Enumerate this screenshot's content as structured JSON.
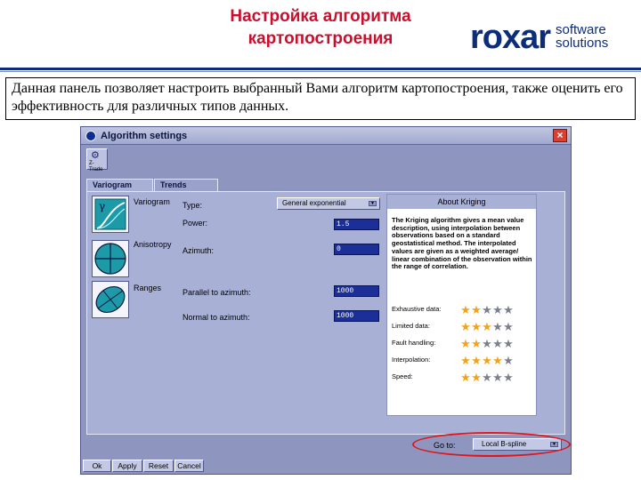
{
  "slide": {
    "title_line1": "Настройка алгоритма",
    "title_line2": "картопостроения",
    "logo_main": "roxar",
    "logo_sub_1": "software",
    "logo_sub_2": "solutions",
    "description": "Данная панель позволяет настроить выбранный Вами алгоритм картопостроения, также оценить его эффективность для различных типов данных."
  },
  "window": {
    "title": "Algorithm settings",
    "close_label": "×",
    "toolbar": {
      "tool_label": "Z-Trade"
    },
    "tabs": [
      {
        "label": "Variogram",
        "active": true
      },
      {
        "label": "Trends",
        "active": false
      }
    ],
    "sections": {
      "variogram": "Variogram",
      "anisotropy": "Anisotropy",
      "ranges": "Ranges"
    },
    "fields": {
      "type_label": "Type:",
      "type_value": "General exponential",
      "power_label": "Power:",
      "power_value": "1.5",
      "azimuth_label": "Azimuth:",
      "azimuth_value": "0",
      "parallel_label": "Parallel to azimuth:",
      "parallel_value": "1000",
      "normal_label": "Normal to azimuth:",
      "normal_value": "1000"
    },
    "info": {
      "header": "About Kriging",
      "text": "The Kriging algorithm gives a mean value description, using interpolation between observations based on a standard geostatistical method. The interpolated values are given as a weighted average/ linear combination of the observation within the range of correlation.",
      "ratings": [
        {
          "label": "Exhaustive data:",
          "stars": 2
        },
        {
          "label": "Limited data:",
          "stars": 3
        },
        {
          "label": "Fault handling:",
          "stars": 2
        },
        {
          "label": "Interpolation:",
          "stars": 4
        },
        {
          "label": "Speed:",
          "stars": 2
        }
      ],
      "max_stars": 5
    },
    "goto": {
      "label": "Go to:",
      "value": "Local B-spline"
    },
    "buttons": {
      "ok": "Ok",
      "apply": "Apply",
      "reset": "Reset",
      "cancel": "Cancel"
    }
  },
  "colors": {
    "title_red": "#c8102e",
    "brand_blue": "#0b2d7a",
    "window_bg": "#8e96c0",
    "input_bg": "#1c2f98",
    "star_on": "#f3a21b",
    "star_off": "#7c7f8c",
    "highlight": "#e0151b"
  }
}
